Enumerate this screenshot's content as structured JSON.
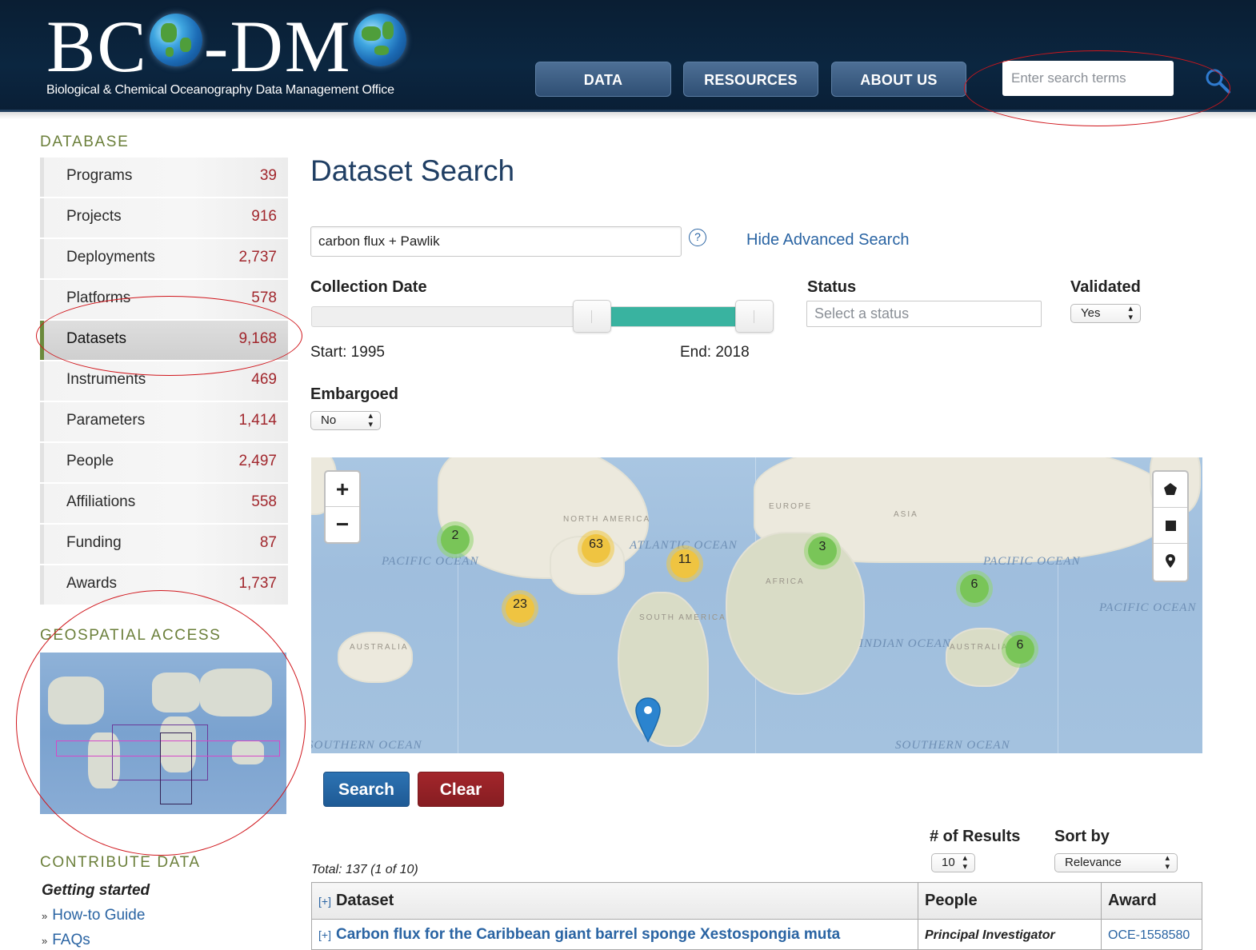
{
  "header": {
    "logo_part1": "BC",
    "logo_part2": "-DM",
    "tagline": "Biological & Chemical Oceanography Data Management Office",
    "nav": [
      "DATA",
      "RESOURCES",
      "ABOUT US"
    ],
    "search_placeholder": "Enter search terms",
    "search_icon": "search-icon"
  },
  "sidebar": {
    "database_title": "DATABASE",
    "items": [
      {
        "label": "Programs",
        "count": "39"
      },
      {
        "label": "Projects",
        "count": "916"
      },
      {
        "label": "Deployments",
        "count": "2,737"
      },
      {
        "label": "Platforms",
        "count": "578"
      },
      {
        "label": "Datasets",
        "count": "9,168",
        "active": true
      },
      {
        "label": "Instruments",
        "count": "469"
      },
      {
        "label": "Parameters",
        "count": "1,414"
      },
      {
        "label": "People",
        "count": "2,497"
      },
      {
        "label": "Affiliations",
        "count": "558"
      },
      {
        "label": "Funding",
        "count": "87"
      },
      {
        "label": "Awards",
        "count": "1,737"
      }
    ],
    "geospatial_title": "GEOSPATIAL ACCESS",
    "contribute_title": "CONTRIBUTE DATA",
    "getting_started": "Getting started",
    "links": [
      "How-to Guide",
      "FAQs"
    ]
  },
  "main": {
    "title": "Dataset Search",
    "query_value": "carbon flux + Pawlik",
    "help_glyph": "?",
    "hide_advanced": "Hide Advanced Search",
    "collection_date_label": "Collection Date",
    "date_range": {
      "min": 1995,
      "max": 2018,
      "start_fraction": 0.65,
      "end_fraction": 0.95
    },
    "start_text": "Start: 1995",
    "end_text": "End: 2018",
    "status_label": "Status",
    "status_placeholder": "Select a status",
    "validated_label": "Validated",
    "validated_value": "Yes",
    "embargoed_label": "Embargoed",
    "embargoed_value": "No",
    "map": {
      "zoom_in": "+",
      "zoom_out": "−",
      "clusters": [
        {
          "count": "2",
          "color": "green"
        },
        {
          "count": "63",
          "color": "yellow"
        },
        {
          "count": "11",
          "color": "yellow"
        },
        {
          "count": "3",
          "color": "green"
        },
        {
          "count": "23",
          "color": "yellow"
        },
        {
          "count": "6",
          "color": "green"
        },
        {
          "count": "6",
          "color": "green"
        }
      ],
      "ocean_labels": [
        "PACIFIC OCEAN",
        "PACIFIC OCEAN",
        "PACIFIC OCEAN",
        "ATLANTIC OCEAN",
        "INDIAN OCEAN",
        "SOUTHERN OCEAN",
        "SOUTHERN OCEAN"
      ],
      "land_labels": [
        "NORTH AMERICA",
        "SOUTH AMERICA",
        "EUROPE",
        "ASIA",
        "AFRICA",
        "AUSTRALIA",
        "AUSTRALIA"
      ]
    },
    "search_button": "Search",
    "clear_button": "Clear",
    "results_label": "# of Results",
    "results_value": "10",
    "sort_label": "Sort by",
    "sort_value": "Relevance",
    "total": "Total: 137 (1 of 10)",
    "table": {
      "expand": "[+]",
      "headers": [
        "Dataset",
        "People",
        "Award"
      ],
      "rows": [
        {
          "dataset": "Carbon flux for the Caribbean giant barrel sponge Xestospongia muta",
          "people": "Principal Investigator",
          "award": "OCE-1558580"
        }
      ]
    }
  },
  "colors": {
    "header_bg": "#0b2640",
    "accent_blue": "#2a64a3",
    "count_red": "#a1262c",
    "section_green": "#6b7f3a",
    "slider_teal": "#39b3a0",
    "annotation_red": "#d0161c"
  }
}
